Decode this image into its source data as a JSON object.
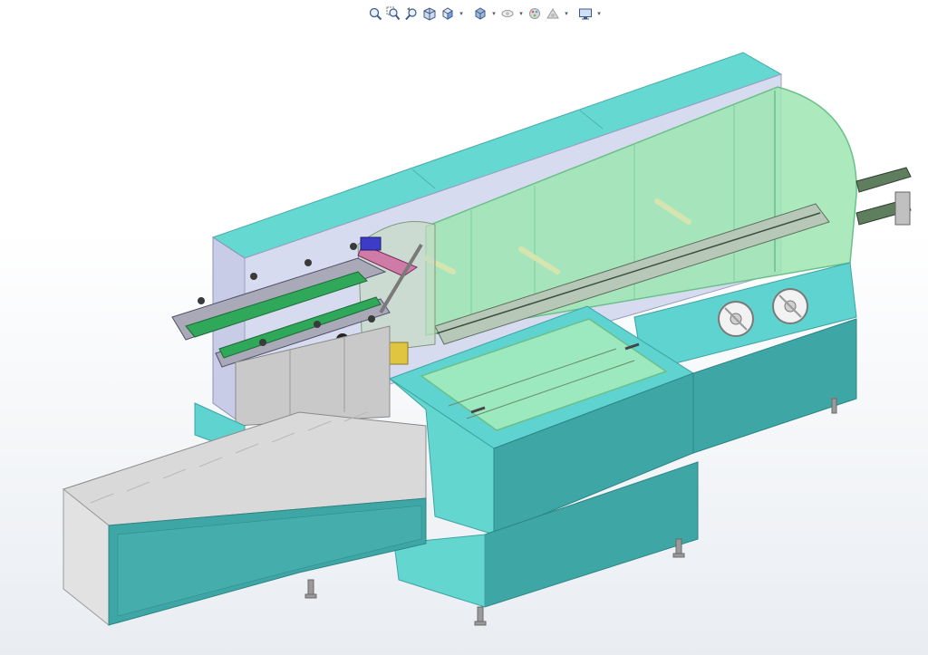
{
  "toolbar": {
    "buttons": [
      {
        "icon": "zoom-to-fit-icon",
        "has_dropdown": false
      },
      {
        "icon": "zoom-to-area-icon",
        "has_dropdown": false
      },
      {
        "icon": "previous-view-icon",
        "has_dropdown": false
      },
      {
        "icon": "section-view-icon",
        "has_dropdown": false
      },
      {
        "icon": "view-orientation-icon",
        "has_dropdown": true
      },
      {
        "icon": "display-style-icon",
        "has_dropdown": true
      },
      {
        "icon": "hide-show-items-icon",
        "has_dropdown": true
      },
      {
        "icon": "edit-appearance-icon",
        "has_dropdown": true
      },
      {
        "icon": "apply-scene-icon",
        "has_dropdown": false
      },
      {
        "icon": "view-settings-icon",
        "has_dropdown": true
      }
    ]
  },
  "colors": {
    "body_teal": "#5fd3cf",
    "body_teal_dark": "#3ea3a3",
    "body_teal_shadow": "#2f8b8d",
    "glass_green": "#9ee6b4",
    "panel_lavender": "#c9cde6",
    "frame_gray": "#c8c8c8",
    "background_top": "#ffffff",
    "background_bottom": "#e9edf2"
  }
}
